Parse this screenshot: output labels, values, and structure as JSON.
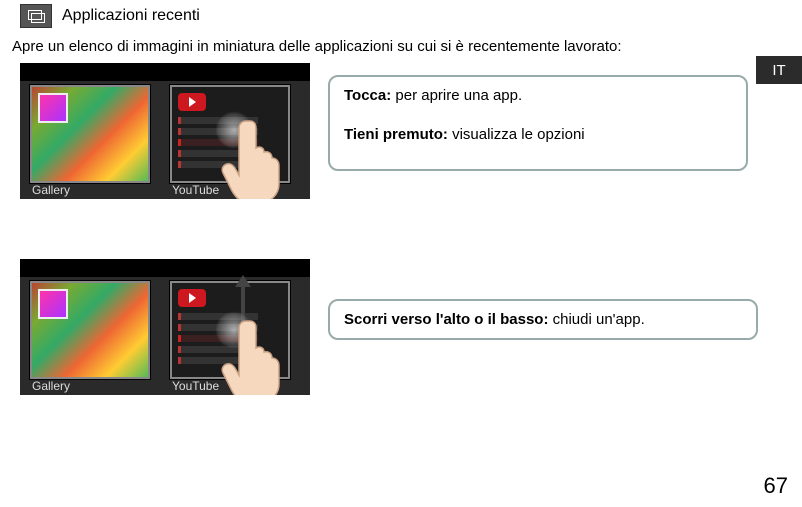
{
  "header": {
    "title": "Applicazioni recenti"
  },
  "intro": "Apre un elenco di immagini in miniatura delle applicazioni su cui si è recentemente lavorato:",
  "lang_tab": "IT",
  "thumbnails": {
    "gallery_label": "Gallery",
    "youtube_label": "YouTube"
  },
  "callout1": {
    "line1_bold": "Tocca:",
    "line1_rest": " per aprire una app.",
    "line2_bold": "Tieni premuto:",
    "line2_rest": " visualizza le opzioni"
  },
  "callout2": {
    "bold": "Scorri verso l'alto o il basso:",
    "rest": " chiudi un'app."
  },
  "page_number": "67"
}
